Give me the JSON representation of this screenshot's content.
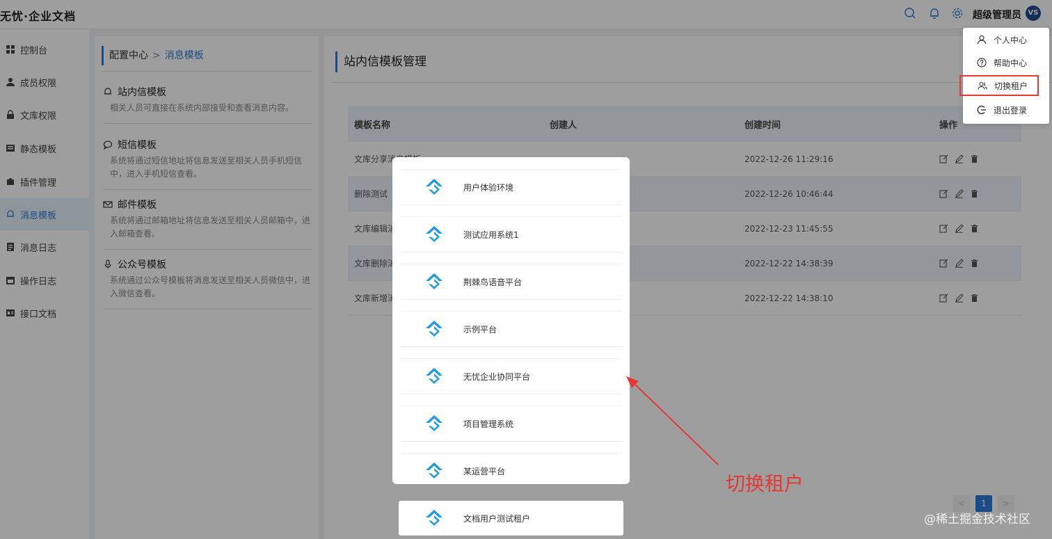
{
  "app": {
    "logo": "无忧·企业文档",
    "username": "超级管理员",
    "avatar": "VS"
  },
  "sidebar": {
    "items": [
      {
        "label": "控制台",
        "icon": "grid-icon"
      },
      {
        "label": "成员权限",
        "icon": "user-icon"
      },
      {
        "label": "文库权限",
        "icon": "lock-icon"
      },
      {
        "label": "静态模板",
        "icon": "template-icon"
      },
      {
        "label": "插件管理",
        "icon": "puzzle-icon"
      },
      {
        "label": "消息模板",
        "icon": "bell-icon",
        "active": true
      },
      {
        "label": "消息日志",
        "icon": "log-icon"
      },
      {
        "label": "操作日志",
        "icon": "calendar-icon"
      },
      {
        "label": "接口文档",
        "icon": "api-icon"
      }
    ]
  },
  "config": {
    "breadcrumb_root": "配置中心",
    "breadcrumb_sep": ">",
    "breadcrumb_current": "消息模板",
    "templates": [
      {
        "title": "站内信模板",
        "icon": "bell-icon",
        "desc": "相关人员可直接在系统内部接受和查看消息内容。"
      },
      {
        "title": "短信模板",
        "icon": "chat-icon",
        "desc": "系统将通过短信地址将信息发送至相关人员手机短信中，进入手机短信查看。"
      },
      {
        "title": "邮件模板",
        "icon": "mail-icon",
        "desc": "系统将通过邮箱地址将信息发送至相关人员邮箱中，进入邮箱查看。"
      },
      {
        "title": "公众号模板",
        "icon": "mic-icon",
        "desc": "系统通过公众号模板将消息发送至相关人员微信中，进入微信查看。"
      }
    ]
  },
  "main": {
    "title": "站内信模板管理",
    "columns": [
      "模板名称",
      "创建人",
      "创建时间",
      "操作"
    ],
    "rows": [
      {
        "name": "文库分享消息模板",
        "creator": "",
        "time": "2022-12-26 11:29:16"
      },
      {
        "name": "删除测试",
        "creator": "",
        "time": "2022-12-26 10:46:44"
      },
      {
        "name": "文库编辑消",
        "creator": "",
        "time": "2022-12-23 11:45:55"
      },
      {
        "name": "文库删除消",
        "creator": "",
        "time": "2022-12-22 14:38:39"
      },
      {
        "name": "文库新增消",
        "creator": "",
        "time": "2022-12-22 14:38:10"
      }
    ],
    "pager": {
      "prev": "<",
      "current": "1",
      "next": ">"
    }
  },
  "user_menu": {
    "items": [
      {
        "label": "个人中心",
        "icon": "user-outline-icon"
      },
      {
        "label": "帮助中心",
        "icon": "help-icon"
      },
      {
        "label": "切换租户",
        "icon": "users-icon",
        "highlighted": true
      },
      {
        "label": "退出登录",
        "icon": "logout-icon"
      }
    ]
  },
  "tenants": {
    "items": [
      "用户体验环境",
      "测试应用系统1",
      "荆棘鸟语音平台",
      "示例平台",
      "无忧企业协同平台",
      "项目管理系统",
      "某运营平台"
    ],
    "extra": "文档用户测试租户"
  },
  "annotation": {
    "text": "切换租户",
    "color": "#e53935"
  },
  "watermark": "@稀土掘金技术社区",
  "colors": {
    "accent": "#2d7bd8",
    "tenant_logo": "#1e9be6"
  }
}
